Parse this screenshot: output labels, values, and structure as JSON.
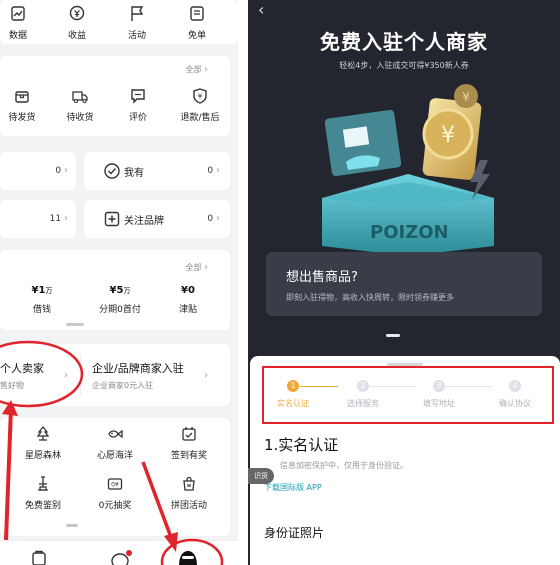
{
  "left": {
    "top_nav": [
      {
        "label": "数据",
        "icon": "chart-icon"
      },
      {
        "label": "收益",
        "icon": "coin-icon"
      },
      {
        "label": "活动",
        "icon": "flag-icon"
      },
      {
        "label": "免单",
        "icon": "ticket-icon"
      }
    ],
    "orders": {
      "all_label": "全部",
      "items": [
        {
          "label": "待发货",
          "icon": "box-icon"
        },
        {
          "label": "待收货",
          "icon": "truck-icon"
        },
        {
          "label": "评价",
          "icon": "comment-icon"
        },
        {
          "label": "退款/售后",
          "icon": "refund-icon"
        }
      ]
    },
    "row1": {
      "left_count": "0",
      "right_icon": "check-circle-icon",
      "right_label": "我有",
      "right_count": "0"
    },
    "row2": {
      "left_count": "11",
      "right_icon": "plus-box-icon",
      "right_label": "关注品牌",
      "right_count": "0"
    },
    "finance": {
      "all_label": "全部",
      "items": [
        {
          "value": "¥1",
          "unit": "万",
          "label": "借钱"
        },
        {
          "value": "¥5",
          "unit": "万",
          "label": "分期0首付"
        },
        {
          "value": "¥0",
          "unit": "",
          "label": "津贴"
        }
      ]
    },
    "seller": {
      "personal_title": "个人卖家",
      "personal_sub": "售好物",
      "company_title": "企业/品牌商家入驻",
      "company_sub": "企业商家0元入驻"
    },
    "grid": [
      {
        "label": "星愿森林",
        "icon": "tree-icon"
      },
      {
        "label": "心愿海洋",
        "icon": "fish-icon"
      },
      {
        "label": "签到有奖",
        "icon": "calendar-check-icon"
      },
      {
        "label": "免费鉴别",
        "icon": "microscope-icon"
      },
      {
        "label": "0元抽奖",
        "icon": "lottery-icon"
      },
      {
        "label": "拼团活动",
        "icon": "bag-icon"
      }
    ]
  },
  "right": {
    "title": "免费入驻个人商家",
    "subtitle": "轻松4步，入驻成交可得¥350新人券",
    "promo_title": "想出售商品?",
    "promo_sub": "即刻入驻得物，高收入快周转，限时领券赚更多",
    "box_text": "POIZON",
    "steps": [
      {
        "n": "1",
        "label": "实名认证",
        "active": true
      },
      {
        "n": "2",
        "label": "选择服务",
        "active": false
      },
      {
        "n": "3",
        "label": "填写地址",
        "active": false
      },
      {
        "n": "4",
        "label": "确认协议",
        "active": false
      }
    ],
    "section_title": "1.实名认证",
    "section_note": "信息加密保护中，仅用于身份验证。",
    "intl_link": "下载国际版 APP",
    "recognize_tag": "识货",
    "id_photo_title": "身份证照片"
  },
  "colors": {
    "accent": "#f2a83b",
    "highlight_red": "#e0242c",
    "dark_bg": "#24262f",
    "link": "#1a9fb0"
  }
}
